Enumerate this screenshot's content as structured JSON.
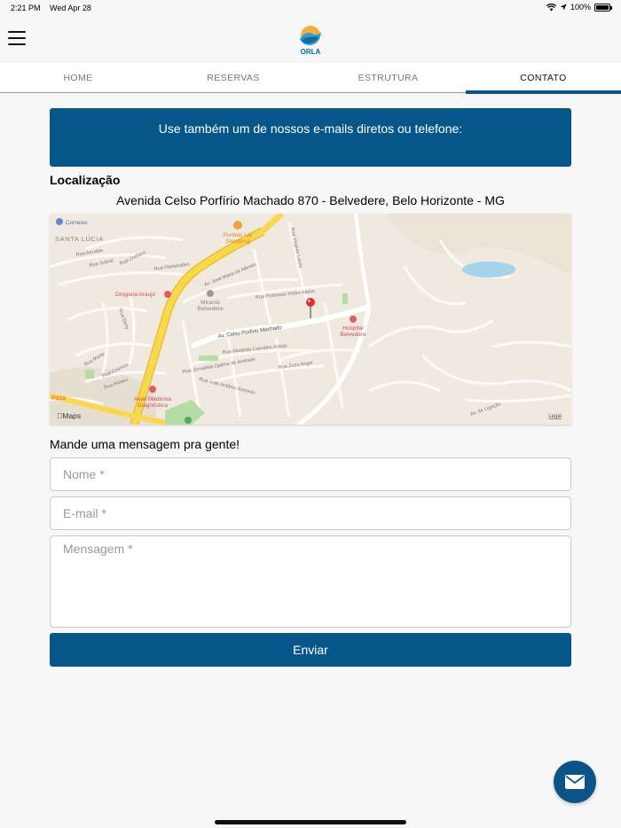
{
  "status": {
    "time": "2:21 PM",
    "date": "Wed Apr 28",
    "battery": "100%",
    "battery_level": 1.0
  },
  "header": {
    "logo_text": "ORLA"
  },
  "tabs": [
    {
      "label": "HOME",
      "active": false
    },
    {
      "label": "RESERVAS",
      "active": false
    },
    {
      "label": "ESTRUTURA",
      "active": false
    },
    {
      "label": "CONTATO",
      "active": true
    }
  ],
  "banner": {
    "text": "Use também um de nossos e-mails diretos ou telefone:"
  },
  "location": {
    "title": "Localização",
    "address": "Avenida Celso Porfírio Machado 870 - Belvedere, Belo Horizonte - MG"
  },
  "map": {
    "attribution": "Maps",
    "legal": "Legal",
    "labels": {
      "correios": "Correios",
      "santa_lucia": "SANTA LÚCIA",
      "ponteio_1": "Ponteio Lar",
      "ponteio_2": "Shopping",
      "drogaria": "Drogaria Araujo",
      "mirante_1": "Mirante",
      "mirante_2": "Belvedere",
      "hospital_1": "Hospital",
      "hospital_2": "Belvedere",
      "axial_1": "Axial Medicina",
      "axial_2": "Diagnóstica",
      "pizza": "Pizza",
      "av_celso": "Av. Celso Porfírio Machado",
      "rua_arrudas": "Rua Arrudas",
      "rua_sobral": "Rua Sobral",
      "rua_jupiter": "Rua Zodíaco",
      "rua_planetoides": "Rua Planetoides",
      "av_jose": "Av. José Maria de Alkmim",
      "rua_prof": "Rua Professor Pedro Aleixo",
      "rua_virginio": "Rua Virgínio Lanza",
      "rua_modesto": "Rua Modesto Carvalho Araújo",
      "rua_jornalista": "Rua Jornalista Djalma de Andrade",
      "rua_zuzu": "Rua Zuzu Angel",
      "rua_joao": "Rua João Antônio Azeredo",
      "rua_marte": "Rua Marte",
      "rua_cosmos": "Rua Cosmos",
      "rua_museu": "Rua Museu",
      "rua_deny": "Rua Deny",
      "av_ligacao": "Av. de Ligação"
    }
  },
  "form": {
    "title": "Mande uma mensagem pra gente!",
    "name_placeholder": "Nome *",
    "email_placeholder": "E-mail *",
    "message_placeholder": "Mensagem *",
    "submit_label": "Enviar"
  },
  "colors": {
    "primary": "#075689",
    "map_bg": "#efe9df",
    "map_water": "#a6d3ea"
  }
}
